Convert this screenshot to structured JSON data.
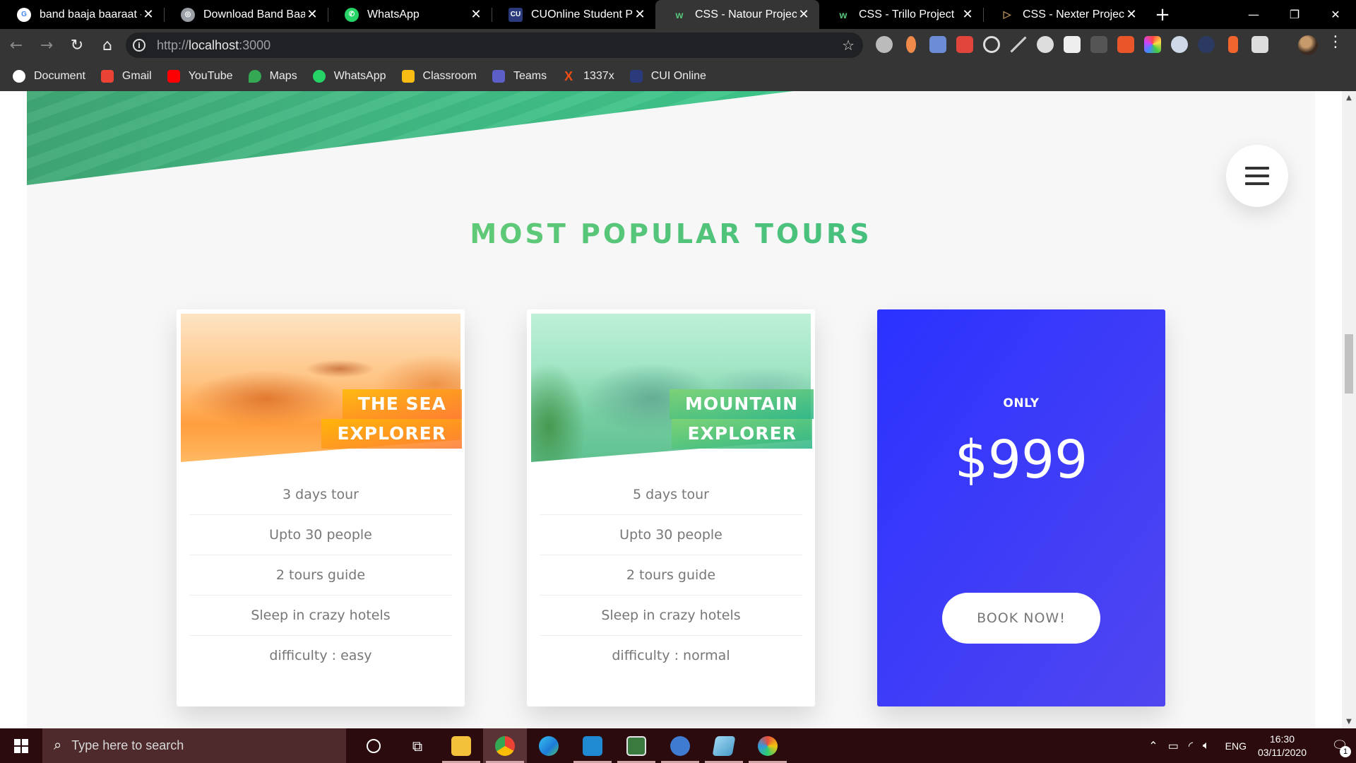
{
  "browser": {
    "tabs": [
      {
        "title": "band baaja baaraat - G",
        "icon": "google-icon",
        "color": "#ffffff"
      },
      {
        "title": "Download Band Baaja",
        "icon": "globe-icon",
        "color": "#9aa0a6"
      },
      {
        "title": "WhatsApp",
        "icon": "whatsapp-icon",
        "color": "#25d366"
      },
      {
        "title": "CUOnline Student Port",
        "icon": "cu-icon",
        "color": "#2a3a7a"
      },
      {
        "title": "CSS - Natour Project",
        "icon": "natours-icon",
        "color": "#55c57a",
        "active": true
      },
      {
        "title": "CSS - Trillo Project",
        "icon": "trillo-icon",
        "color": "#55c57a"
      },
      {
        "title": "CSS - Nexter Project",
        "icon": "nexter-icon",
        "color": "#b08d57"
      }
    ],
    "url_scheme": "http://",
    "url_host": "localhost",
    "url_port": ":3000",
    "bookmarks": [
      {
        "label": "Document",
        "icon": "document-icon",
        "color": "#ffffff"
      },
      {
        "label": "Gmail",
        "icon": "gmail-icon",
        "color": "#ea4335"
      },
      {
        "label": "YouTube",
        "icon": "youtube-icon",
        "color": "#ff0000"
      },
      {
        "label": "Maps",
        "icon": "maps-icon",
        "color": "#34a853"
      },
      {
        "label": "WhatsApp",
        "icon": "whatsapp-icon",
        "color": "#25d366"
      },
      {
        "label": "Classroom",
        "icon": "classroom-icon",
        "color": "#f9bc15"
      },
      {
        "label": "Teams",
        "icon": "teams-icon",
        "color": "#5b5fc7"
      },
      {
        "label": "1337x",
        "icon": "1337x-icon",
        "color": "#f14e13"
      },
      {
        "label": "CUI Online",
        "icon": "cu-icon",
        "color": "#2a3a7a"
      }
    ]
  },
  "page": {
    "section_title": "MOST POPULAR TOURS",
    "cards": [
      {
        "heading_line1": "THE SEA",
        "heading_line2": "EXPLORER",
        "details": [
          "3 days tour",
          "Upto 30 people",
          "2 tours guide",
          "Sleep in crazy hotels",
          "difficulty : easy"
        ]
      },
      {
        "heading_line1": "MOUNTAIN",
        "heading_line2": "EXPLORER",
        "details": [
          "5 days tour",
          "Upto 30 people",
          "2 tours guide",
          "Sleep in crazy hotels",
          "difficulty : normal"
        ]
      }
    ],
    "back_card": {
      "only_label": "ONLY",
      "price": "$999",
      "button_label": "BOOK NOW!"
    },
    "colors": {
      "green_light": "#7ed56f",
      "green_dark": "#28b485",
      "orange_light": "#ffb900",
      "orange_dark": "#ff7730",
      "blue_back": "#2b32ff"
    }
  },
  "taskbar": {
    "search_placeholder": "Type here to search",
    "language": "ENG",
    "time": "16:30",
    "date": "03/11/2020",
    "notification_count": "1"
  }
}
